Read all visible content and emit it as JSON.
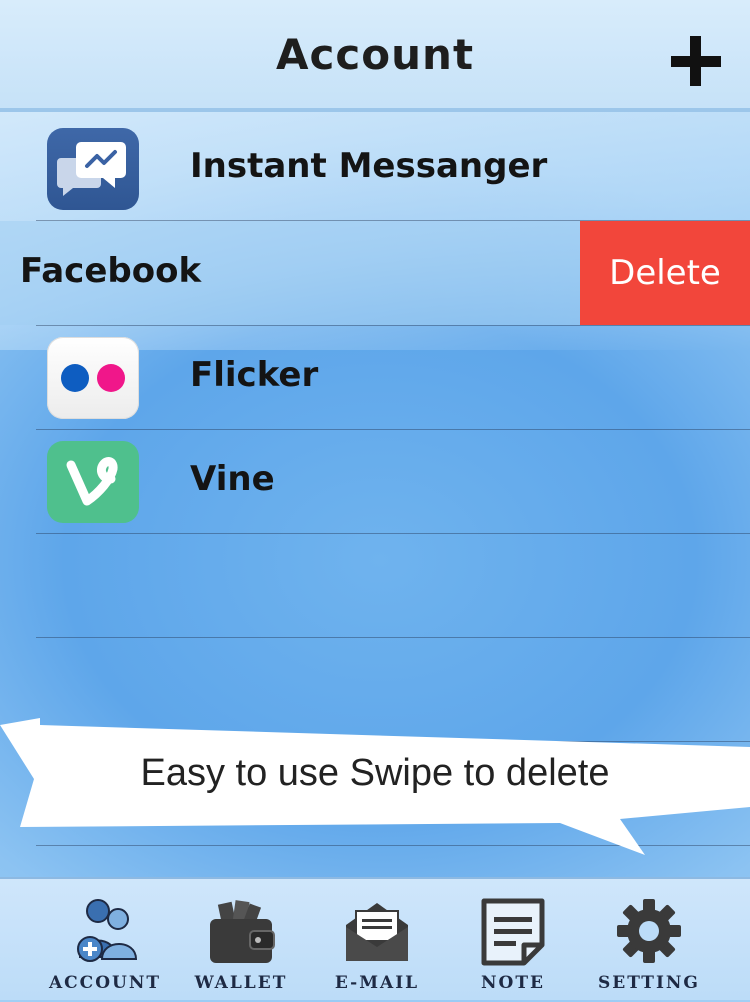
{
  "header": {
    "title": "Account",
    "add_icon": "plus-icon"
  },
  "accounts": [
    {
      "label": "Instant Messanger",
      "icon": "messenger-icon"
    },
    {
      "label": "Facebook",
      "action": "Delete"
    },
    {
      "label": "Flicker",
      "icon": "flickr-icon"
    },
    {
      "label": "Vine",
      "icon": "vine-icon"
    }
  ],
  "banner": {
    "text": "Easy to use Swipe to delete"
  },
  "tabs": [
    {
      "label": "ACCOUNT",
      "icon": "account-icon"
    },
    {
      "label": "WALLET",
      "icon": "wallet-icon"
    },
    {
      "label": "E-MAIL",
      "icon": "email-icon"
    },
    {
      "label": "NOTE",
      "icon": "note-icon"
    },
    {
      "label": "SETTING",
      "icon": "gear-icon"
    }
  ],
  "colors": {
    "delete": "#f2463b",
    "header_bg": "#d0e7fa",
    "background": "#5ea6ea"
  }
}
